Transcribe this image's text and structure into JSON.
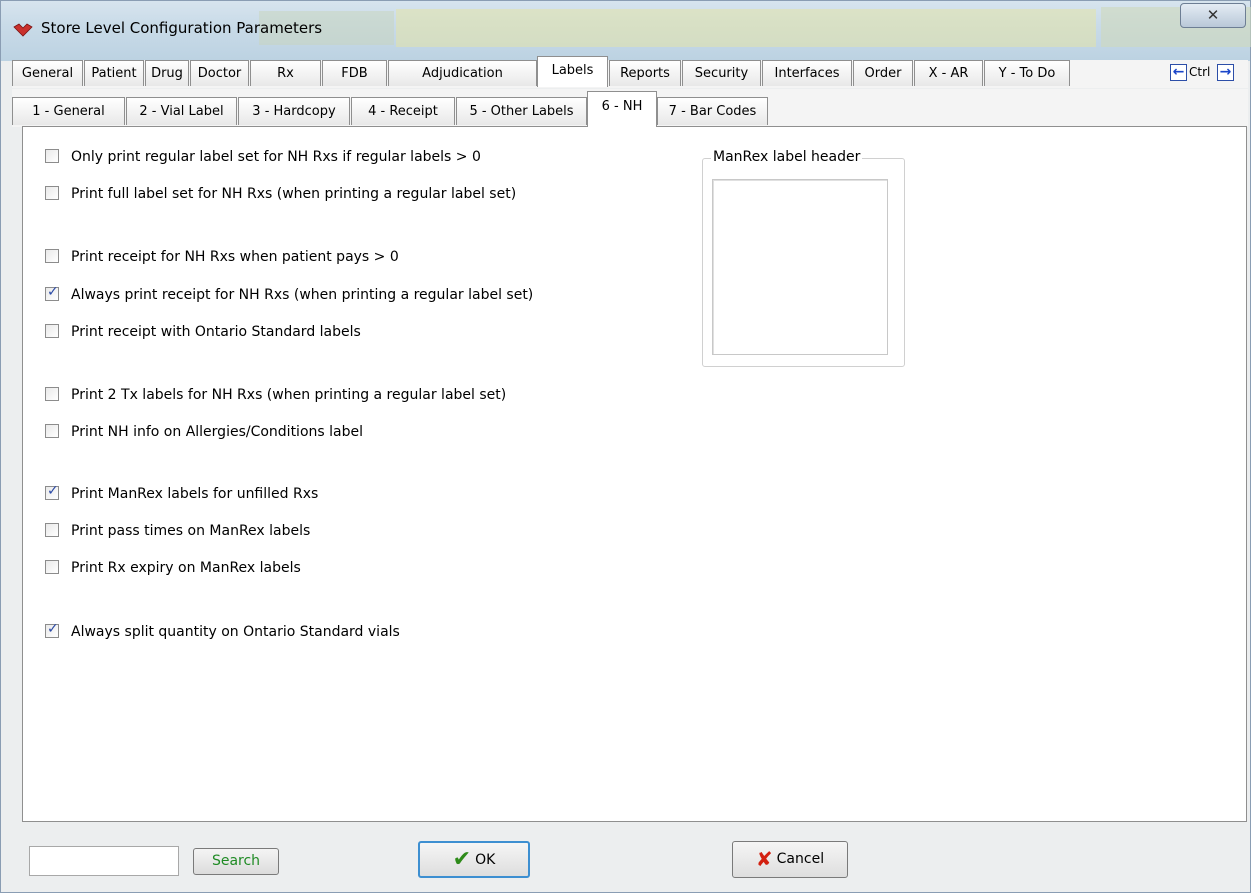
{
  "window": {
    "title": "Store Level Configuration Parameters",
    "close_glyph": "✕",
    "app_icon": "red-pill-icon"
  },
  "tabs_top": [
    {
      "label": "General"
    },
    {
      "label": "Patient"
    },
    {
      "label": "Drug"
    },
    {
      "label": "Doctor"
    },
    {
      "label": "Rx"
    },
    {
      "label": "FDB"
    },
    {
      "label": "Adjudication"
    },
    {
      "label": "Labels",
      "active": true
    },
    {
      "label": "Reports"
    },
    {
      "label": "Security"
    },
    {
      "label": "Interfaces"
    },
    {
      "label": "Order"
    },
    {
      "label": "X - AR"
    },
    {
      "label": "Y - To Do"
    }
  ],
  "ctrl_nav": {
    "label": "Ctrl",
    "left_arrow": "←",
    "right_arrow": "→"
  },
  "tabs_sub": [
    {
      "label": "1 - General"
    },
    {
      "label": "2 - Vial Label"
    },
    {
      "label": "3 - Hardcopy"
    },
    {
      "label": "4 - Receipt"
    },
    {
      "label": "5 - Other Labels"
    },
    {
      "label": "6 - NH",
      "active": true
    },
    {
      "label": "7 - Bar Codes"
    }
  ],
  "options": [
    {
      "label": "Only print regular label set for NH Rxs if regular labels > 0",
      "checked": false
    },
    {
      "label": "Print full label set for NH Rxs (when printing a regular label set)",
      "checked": false
    },
    {
      "label": "Print receipt for NH Rxs when patient pays > 0",
      "checked": false
    },
    {
      "label": "Always print receipt for NH Rxs (when printing a regular label set)",
      "checked": true
    },
    {
      "label": "Print receipt with Ontario Standard labels",
      "checked": false
    },
    {
      "label": "Print 2 Tx labels for NH Rxs (when printing a regular label set)",
      "checked": false
    },
    {
      "label": "Print NH info on Allergies/Conditions label",
      "checked": false
    },
    {
      "label": "Print ManRex labels for unfilled Rxs",
      "checked": true
    },
    {
      "label": "Print pass times on ManRex labels",
      "checked": false
    },
    {
      "label": "Print Rx expiry on ManRex labels",
      "checked": false
    },
    {
      "label": "Always split quantity on Ontario Standard vials",
      "checked": true
    }
  ],
  "manrex_group": {
    "legend": "ManRex label header",
    "value": ""
  },
  "bottom": {
    "search_value": "",
    "search_label": "Search",
    "ok_label": "OK",
    "cancel_label": "Cancel"
  }
}
